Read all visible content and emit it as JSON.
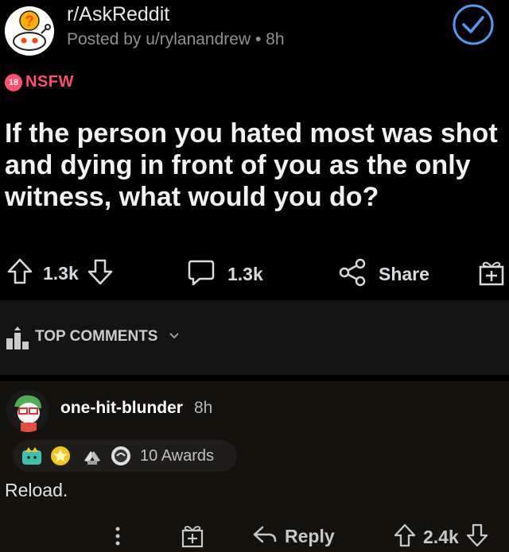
{
  "post": {
    "subreddit": "r/AskReddit",
    "posted_by": "Posted by u/rylanandrew • 8h",
    "nsfw_badge": "18",
    "nsfw_label": "NSFW",
    "title": "If the person you hated most was shot and dying in front of you as the only witness, what would you do?"
  },
  "actions": {
    "upvotes": "1.3k",
    "comments": "1.3k",
    "share_label": "Share"
  },
  "comments_header": {
    "sort_label": "TOP COMMENTS"
  },
  "comment": {
    "author": "one-hit-blunder",
    "time": "8h",
    "awards_label": "10 Awards",
    "body": "Reload.",
    "reply_label": "Reply",
    "votes": "2.4k"
  },
  "icons": {
    "subreddit_avatar": "askreddit-snoo-icon",
    "verified": "check-circle-icon",
    "upvote": "arrow-up-icon",
    "downvote": "arrow-down-icon",
    "comment": "speech-bubble-icon",
    "share": "share-icon",
    "award": "gift-icon",
    "sort": "podium-icon",
    "more": "dots-vertical-icon",
    "reply": "reply-arrow-icon"
  },
  "colors": {
    "nsfw": "#ff4f6b",
    "check": "#4f9cf5",
    "background": "#000000"
  }
}
